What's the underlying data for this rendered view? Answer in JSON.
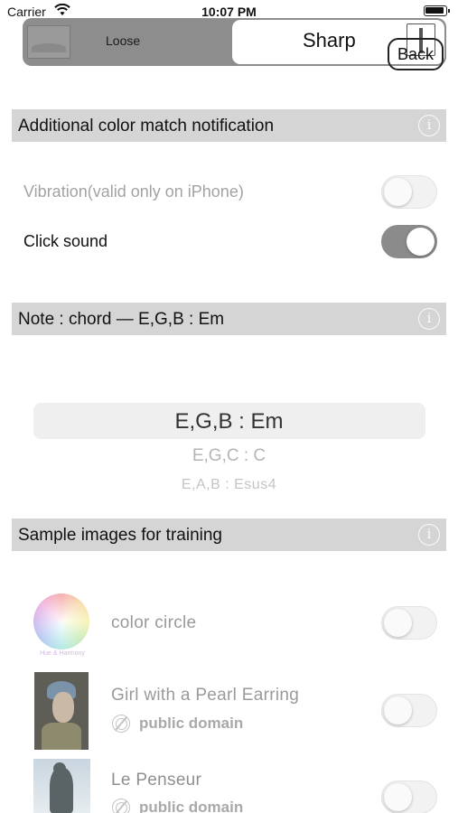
{
  "status_bar": {
    "carrier": "Carrier",
    "time": "10:07 PM"
  },
  "segment": {
    "left_label": "Loose",
    "right_label": "Sharp",
    "back_label": "Back",
    "selected": "Sharp"
  },
  "notification_section": {
    "title": "Additional color match notification",
    "info_icon": "info-icon",
    "rows": [
      {
        "label": "Vibration(valid only on iPhone)",
        "enabled": false,
        "toggle_on": false
      },
      {
        "label": "Click sound",
        "enabled": true,
        "toggle_on": true
      }
    ]
  },
  "note_section": {
    "title": "Note : chord — E,G,B : Em",
    "picker_options": [
      "E,G,B : Em",
      "E,G,C : C",
      "E,A,B : Esus4"
    ],
    "selected_index": 0
  },
  "samples_section": {
    "title": "Sample images for training",
    "items": [
      {
        "label": "color circle",
        "caption": "Hue & Harmony",
        "toggle_on": false
      },
      {
        "label": "Girl with a Pearl Earring",
        "license": "public domain",
        "toggle_on": false
      },
      {
        "label": "Le Penseur",
        "license": "public domain",
        "toggle_on": false
      }
    ]
  },
  "colors": {
    "header_bg": "#d5d5d5",
    "segment_bg": "#8d8d8d",
    "toggle_on": "#8b8b8b"
  }
}
